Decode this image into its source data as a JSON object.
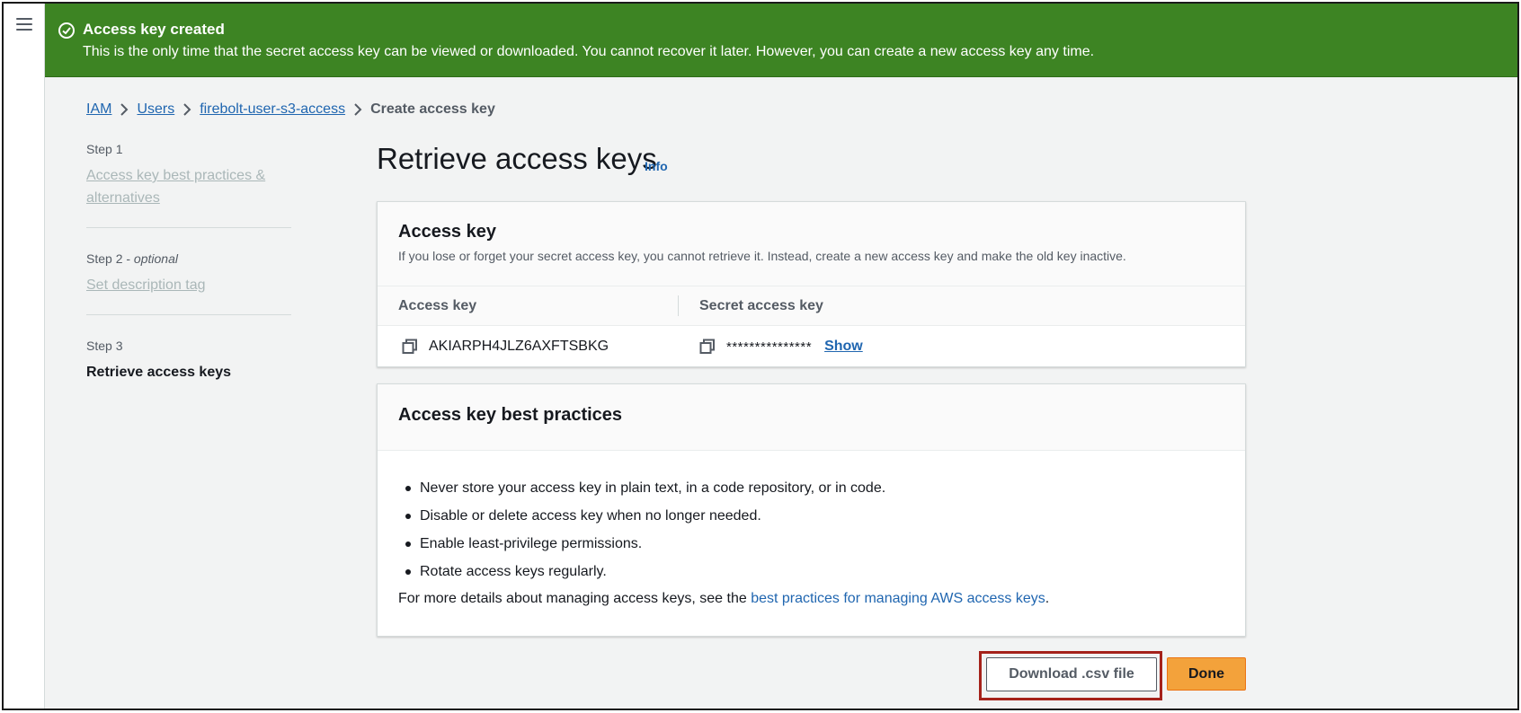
{
  "flash": {
    "title": "Access key created",
    "message": "This is the only time that the secret access key can be viewed or downloaded. You cannot recover it later. However, you can create a new access key any time.",
    "color": "#3d8423",
    "icon": "check-circle-icon"
  },
  "nav": {
    "icon": "hamburger-menu-icon"
  },
  "breadcrumb": {
    "items": [
      "IAM",
      "Users",
      "firebolt-user-s3-access"
    ],
    "current": "Create access key",
    "separator_icon": "chevron-right-icon"
  },
  "steps": [
    {
      "label": "Step 1",
      "label_suffix": "",
      "title": "Access key best practices & alternatives"
    },
    {
      "label": "Step 2 - ",
      "label_suffix": "optional",
      "title": "Set description tag"
    },
    {
      "label": "Step 3",
      "label_suffix": "",
      "title": "Retrieve access keys"
    }
  ],
  "page": {
    "title": "Retrieve access keys",
    "info": "Info"
  },
  "access_key_card": {
    "title": "Access key",
    "description": "If you lose or forget your secret access key, you cannot retrieve it. Instead, create a new access key and make the old key inactive.",
    "columns": [
      "Access key",
      "Secret access key"
    ],
    "access_key_value": "AKIARPH4JLZ6AXFTSBKG",
    "secret_value": "***************",
    "show_label": "Show",
    "copy_icon": "copy-icon"
  },
  "best_practices_card": {
    "title": "Access key best practices",
    "items": [
      "Never store your access key in plain text, in a code repository, or in code.",
      "Disable or delete access key when no longer needed.",
      "Enable least-privilege permissions.",
      "Rotate access keys regularly."
    ],
    "more_prefix": "For more details about managing access keys, see the ",
    "more_link": "best practices for managing AWS access keys",
    "more_suffix": "."
  },
  "actions": {
    "download_label": "Download .csv file",
    "done_label": "Done",
    "primary_color": "#f3a23b",
    "highlight_color": "#a5221b"
  }
}
